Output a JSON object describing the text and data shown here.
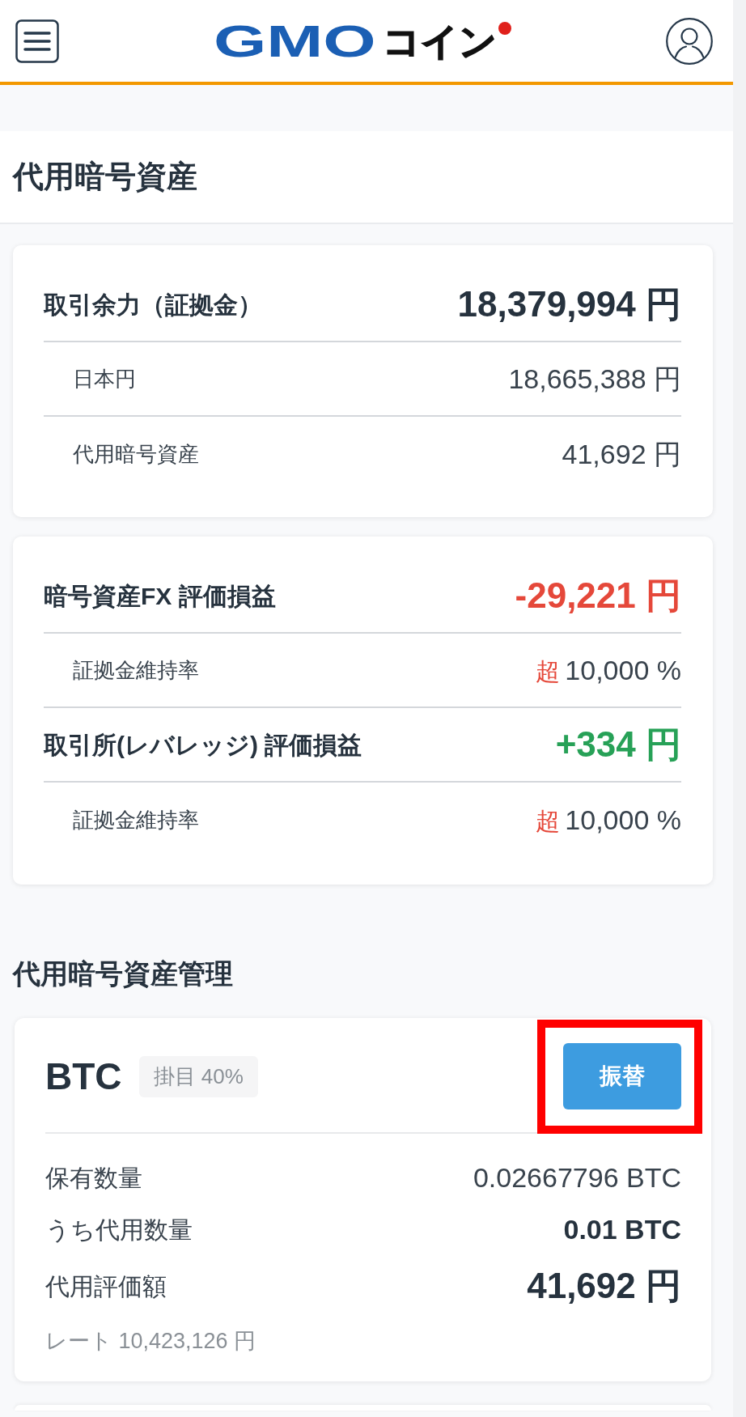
{
  "header": {
    "logo": {
      "brand": "GMO",
      "suffix": "コイン"
    }
  },
  "page_title": "代用暗号資産",
  "summary_cards": [
    {
      "rows": [
        {
          "kind": "main",
          "label": "取引余力（証拠金）",
          "value": "18,379,994 円",
          "color": "#26323e"
        },
        {
          "kind": "sub",
          "label": "日本円",
          "value": "18,665,388 円"
        },
        {
          "kind": "sub",
          "label": "代用暗号資産",
          "value": "41,692 円"
        }
      ]
    },
    {
      "rows": [
        {
          "kind": "main",
          "label": "暗号資産FX 評価損益",
          "value": "-29,221 円",
          "color": "#e5483a"
        },
        {
          "kind": "sub",
          "label": "証拠金維持率",
          "prefix": "超",
          "value": "10,000 %"
        },
        {
          "kind": "main",
          "label": "取引所(レバレッジ) 評価損益",
          "value": "+334 円",
          "color": "#27a157"
        },
        {
          "kind": "sub",
          "label": "証拠金維持率",
          "prefix": "超",
          "value": "10,000 %"
        }
      ]
    }
  ],
  "management": {
    "title": "代用暗号資産管理",
    "assets": [
      {
        "symbol": "BTC",
        "haircut": "掛目 40%",
        "button": {
          "label": "振替",
          "highlighted": true
        },
        "rows": [
          {
            "kind": "plain",
            "label": "保有数量",
            "value": "0.02667796 BTC"
          },
          {
            "kind": "bold",
            "label": "うち代用数量",
            "value": "0.01 BTC"
          },
          {
            "kind": "large",
            "label": "代用評価額",
            "value": "41,692 円"
          }
        ],
        "rate": "レート 10,423,126 円"
      }
    ]
  }
}
